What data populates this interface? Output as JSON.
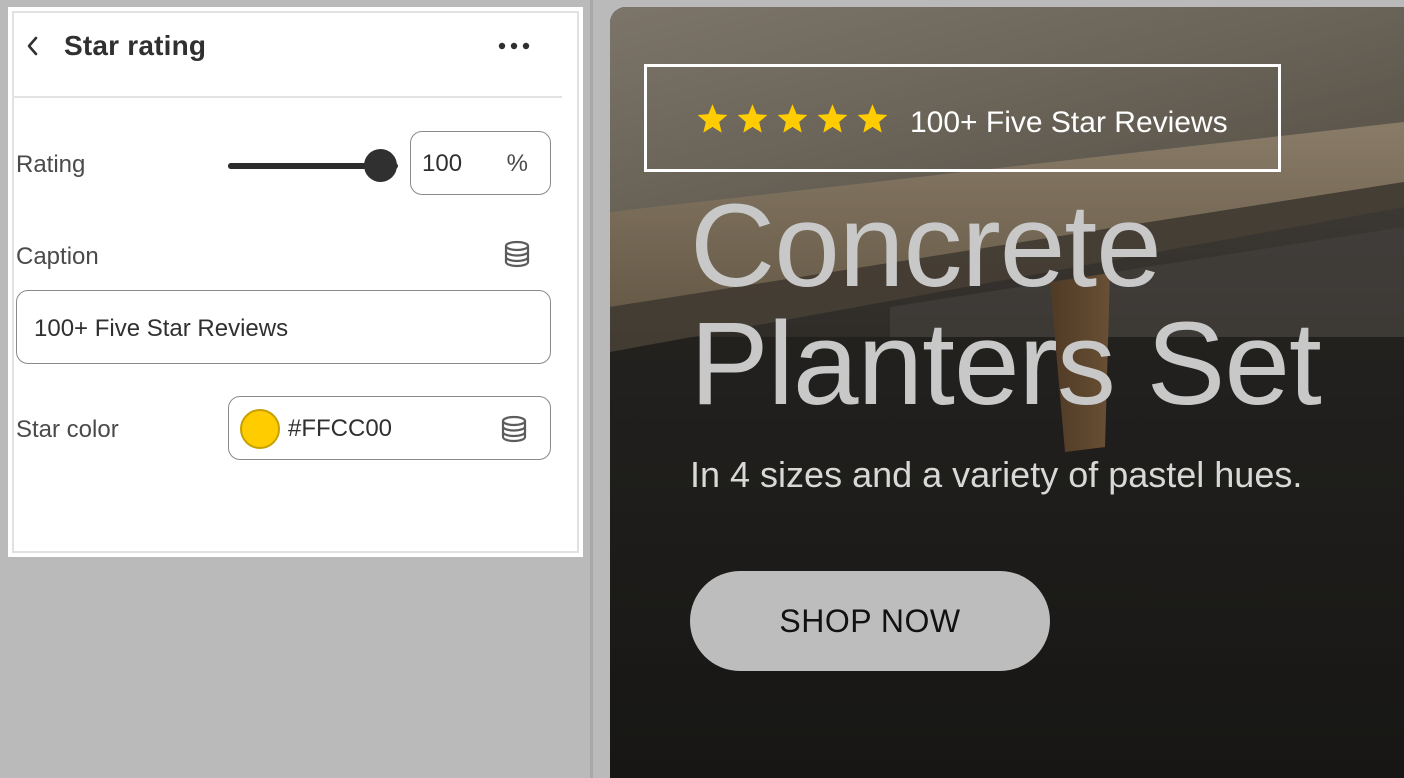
{
  "panel": {
    "title": "Star rating",
    "back_icon": "chevron-left-icon",
    "more_icon": "more-horizontal-icon",
    "rating": {
      "label": "Rating",
      "value": 100,
      "value_text": "100",
      "suffix": "%"
    },
    "caption": {
      "label": "Caption",
      "value": "100+ Five Star Reviews",
      "source_icon": "database-icon"
    },
    "star_color": {
      "label": "Star color",
      "value": "#FFCC00",
      "source_icon": "database-icon"
    }
  },
  "preview": {
    "stars_count": 5,
    "star_color": "#FFCC00",
    "review_caption": "100+ Five Star Reviews",
    "title_line1": "Concrete",
    "title_line2": "Planters Set",
    "subtitle": "In 4 sizes and a variety of pastel hues.",
    "cta_label": "SHOP NOW"
  }
}
